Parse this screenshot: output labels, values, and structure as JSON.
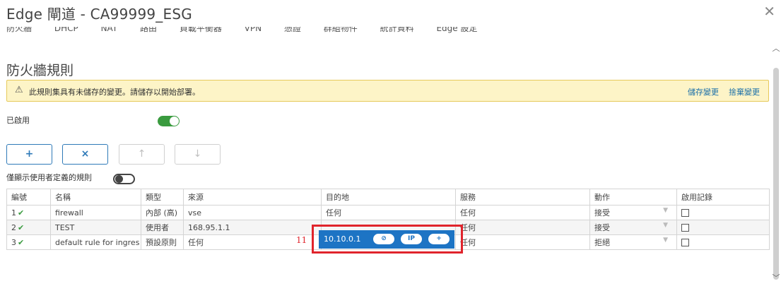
{
  "window": {
    "title": "Edge 閘道 - CA99999_ESG"
  },
  "tabs": [
    "防火牆",
    "DHCP",
    "NAT",
    "路由",
    "負載平衡器",
    "VPN",
    "憑證",
    "群組物件",
    "統計資料",
    "Edge 設定"
  ],
  "page": {
    "section_title": "防火牆規則"
  },
  "alert": {
    "message": "此規則集具有未儲存的變更。請儲存以開始部署。",
    "save_label": "儲存變更",
    "discard_label": "捨棄變更"
  },
  "enabled": {
    "label": "已啟用",
    "state": true
  },
  "toolbar": {
    "add": "+",
    "delete": "×",
    "up": "↑",
    "down": "↓"
  },
  "filter": {
    "user_rules_label": "僅顯示使用者定義的規則",
    "state": false
  },
  "table": {
    "headers": [
      "編號",
      "名稱",
      "類型",
      "來源",
      "目的地",
      "服務",
      "動作",
      "啟用記錄"
    ],
    "rows": [
      {
        "no": "1",
        "name": "firewall",
        "type": "內部 (高)",
        "source": "vse",
        "destination": "任何",
        "service": "任何",
        "action": "接受"
      },
      {
        "no": "2",
        "name": "TEST",
        "type": "使用者",
        "source": "168.95.1.1",
        "destination": "10.10.0.1",
        "service": "任何",
        "action": "接受"
      },
      {
        "no": "3",
        "name": "default rule for ingres",
        "type": "預設原則",
        "source": "任何",
        "destination": "任何",
        "service": "任何",
        "action": "拒絕"
      }
    ]
  },
  "dest_editor": {
    "value": "10.10.0.1",
    "pill_ip": "IP",
    "pill_add": "+"
  },
  "annotation": {
    "label": "11",
    "color": "#e0242c"
  },
  "colors": {
    "accent": "#1d74c4",
    "success": "#3a9b3f",
    "warning_bg": "#fdf4c7",
    "highlight": "#e0242c"
  }
}
